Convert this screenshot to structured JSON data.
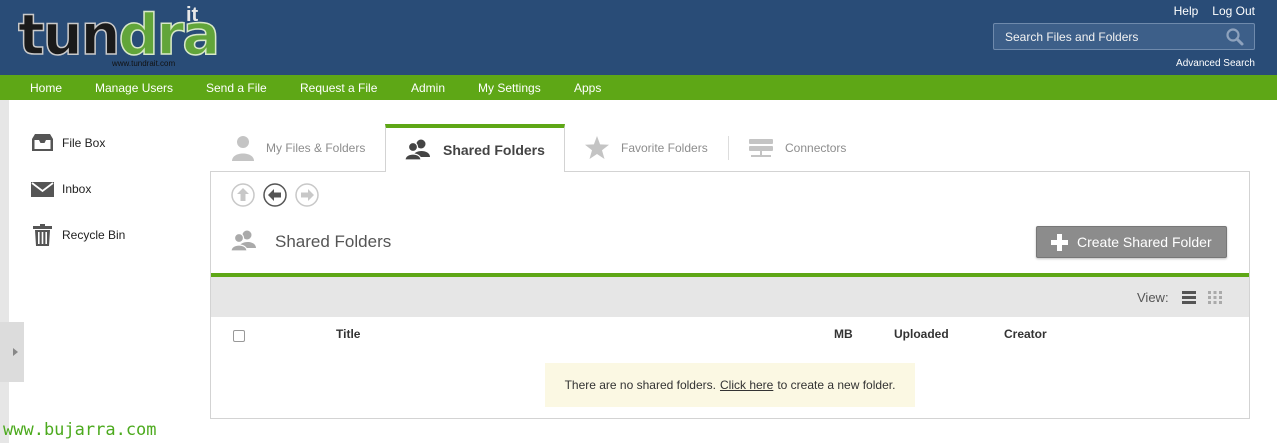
{
  "header": {
    "logo_text_dark": "tun",
    "logo_text_green": "dra",
    "logo_superscript": "it",
    "logo_url": "www.tundrait.com",
    "top_links": [
      "Help",
      "Log Out"
    ],
    "search_placeholder": "Search Files and Folders",
    "advanced_search": "Advanced Search",
    "bg_color": "#294c77"
  },
  "nav": {
    "items": [
      "Home",
      "Manage Users",
      "Send a File",
      "Request a File",
      "Admin",
      "My Settings",
      "Apps"
    ],
    "bg_color": "#5ea716"
  },
  "sidebar": {
    "items": [
      {
        "label": "File Box",
        "icon": "inbox-tray-icon"
      },
      {
        "label": "Inbox",
        "icon": "envelope-icon"
      },
      {
        "label": "Recycle Bin",
        "icon": "trash-icon"
      }
    ]
  },
  "tabs": [
    {
      "label": "My Files & Folders",
      "icon": "user-icon",
      "active": false
    },
    {
      "label": "Shared Folders",
      "icon": "users-icon",
      "active": true
    },
    {
      "label": "Favorite Folders",
      "icon": "star-icon",
      "active": false
    },
    {
      "label": "Connectors",
      "icon": "server-icon",
      "active": false
    }
  ],
  "panel": {
    "title": "Shared Folders",
    "create_button": "Create Shared Folder",
    "view_label": "View:",
    "columns": [
      "Title",
      "MB",
      "Uploaded",
      "Creator"
    ],
    "empty_message_before": "There are no shared folders.",
    "empty_message_link": "Click here",
    "empty_message_after": "to create a new folder."
  },
  "watermark": "www.bujarra.com"
}
